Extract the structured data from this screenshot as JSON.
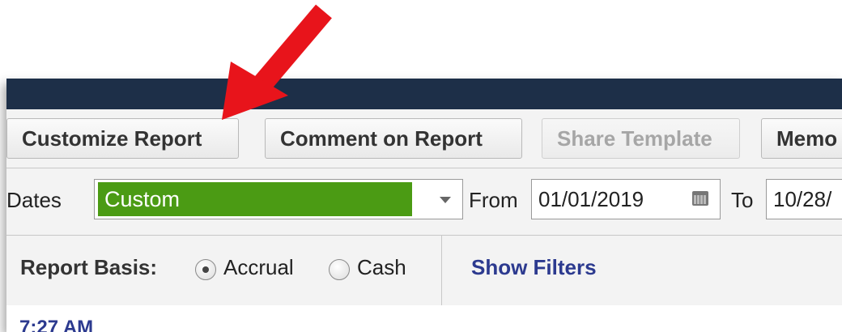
{
  "toolbar": {
    "customize_report": "Customize Report",
    "comment_on_report": "Comment on Report",
    "share_template": "Share Template",
    "memorize": "Memo"
  },
  "dates": {
    "label": "Dates",
    "selected": "Custom",
    "from_label": "From",
    "from_value": "01/01/2019",
    "to_label": "To",
    "to_value": "10/28/"
  },
  "basis": {
    "label": "Report Basis:",
    "options": [
      "Accrual",
      "Cash"
    ],
    "selected": "Accrual"
  },
  "filters": {
    "show_filters": "Show Filters"
  },
  "report": {
    "time": "7:27 AM"
  },
  "colors": {
    "titlebar": "#1d2f48",
    "dates_highlight": "#4b9b14",
    "link": "#2c3a8f",
    "annotation_arrow": "#e8141b"
  }
}
